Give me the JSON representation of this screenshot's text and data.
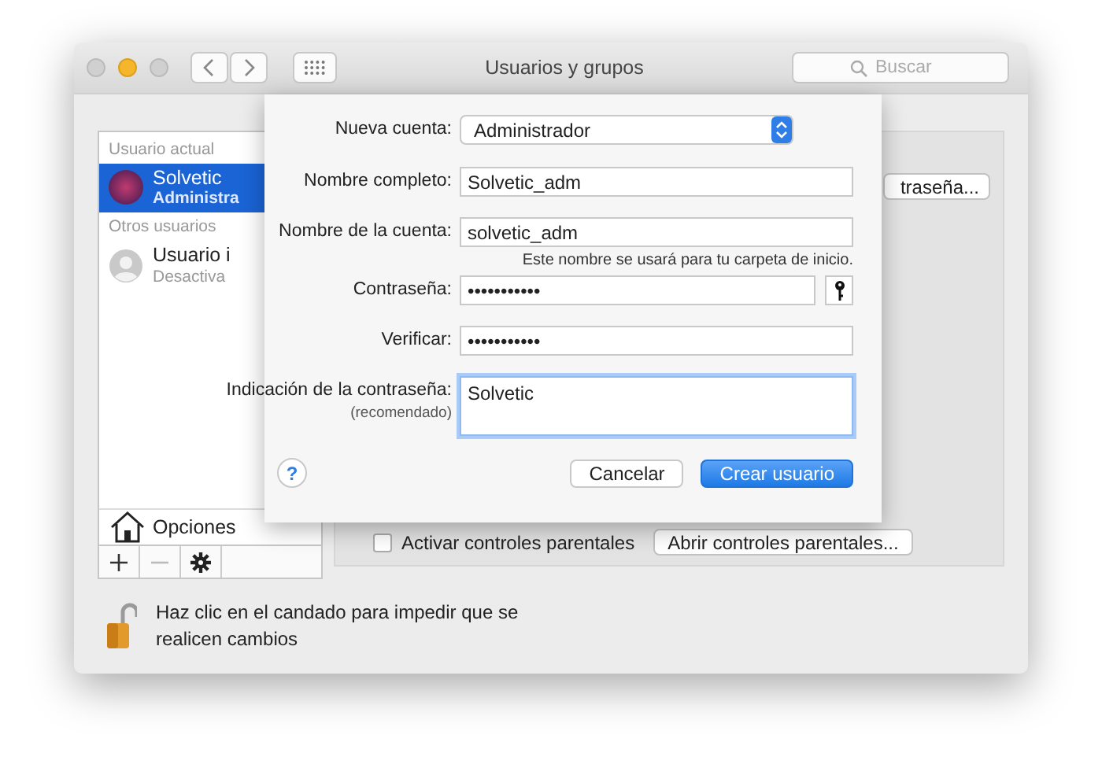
{
  "window": {
    "title": "Usuarios y grupos",
    "search": {
      "placeholder": "Buscar"
    }
  },
  "sidebar": {
    "sections": [
      {
        "heading": "Usuario actual",
        "users": [
          {
            "name": "Solvetic",
            "subtitle": "Administra",
            "kind": "picture",
            "selected": true
          }
        ]
      },
      {
        "heading": "Otros usuarios",
        "users": [
          {
            "name": "Usuario i",
            "subtitle": "Desactiva",
            "kind": "guest",
            "selected": false
          }
        ]
      }
    ],
    "options_label": "Opciones"
  },
  "right_panel": {
    "top_button": "traseña...",
    "checkbox": {
      "label": "Activar controles parentales",
      "checked": false
    },
    "bottom_button": "Abrir controles parentales..."
  },
  "lock": {
    "text": "Haz clic en el candado para impedir que se realicen cambios"
  },
  "sheet": {
    "rows": [
      {
        "kind": "popup",
        "label": "Nueva cuenta:",
        "value": "Administrador"
      },
      {
        "kind": "text",
        "label": "Nombre completo:",
        "value": "Solvetic_adm"
      },
      {
        "kind": "text",
        "label": "Nombre de la cuenta:",
        "value": "solvetic_adm",
        "hint": "Este nombre se usará para tu carpeta de inicio."
      },
      {
        "kind": "password",
        "label": "Contraseña:",
        "value": "•••••••••••"
      },
      {
        "kind": "text",
        "label": "Verificar:",
        "value": "•••••••••••"
      },
      {
        "kind": "area",
        "label": "Indicación de la contraseña:",
        "sublabel": "(recomendado)",
        "value": "Solvetic",
        "focused": true
      }
    ],
    "help_label": "?",
    "buttons": [
      {
        "label": "Cancelar",
        "default": false
      },
      {
        "label": "Crear usuario",
        "default": true
      }
    ]
  }
}
